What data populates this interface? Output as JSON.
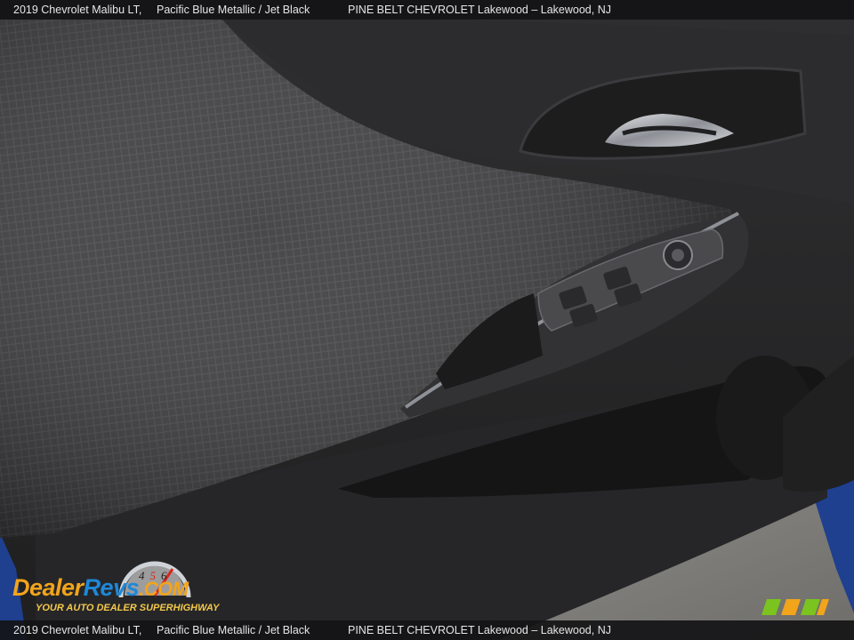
{
  "caption": {
    "vehicle": "2019 Chevrolet Malibu LT,",
    "color": "Pacific Blue Metallic / Jet Black",
    "dealer": "PINE BELT CHEVROLET Lakewood – Lakewood, NJ"
  },
  "watermark": {
    "brand_dealer": "Dealer",
    "brand_revs": "Revs",
    "brand_com": ".COM",
    "tagline": "YOUR AUTO DEALER SUPERHIGHWAY",
    "gauge_digits": "456"
  },
  "colors": {
    "caption_bar": "#141416",
    "fabric": "#3c3c3e",
    "trim": "#29292a",
    "chrome": "#c9ccd0",
    "exterior_blue": "#1f3f8f",
    "brand_orange": "#f2a41b",
    "brand_blue": "#1e88d8"
  },
  "icons": [
    "window-switch-icon",
    "mirror-control-icon",
    "lock-switch-icon",
    "door-handle-icon"
  ]
}
